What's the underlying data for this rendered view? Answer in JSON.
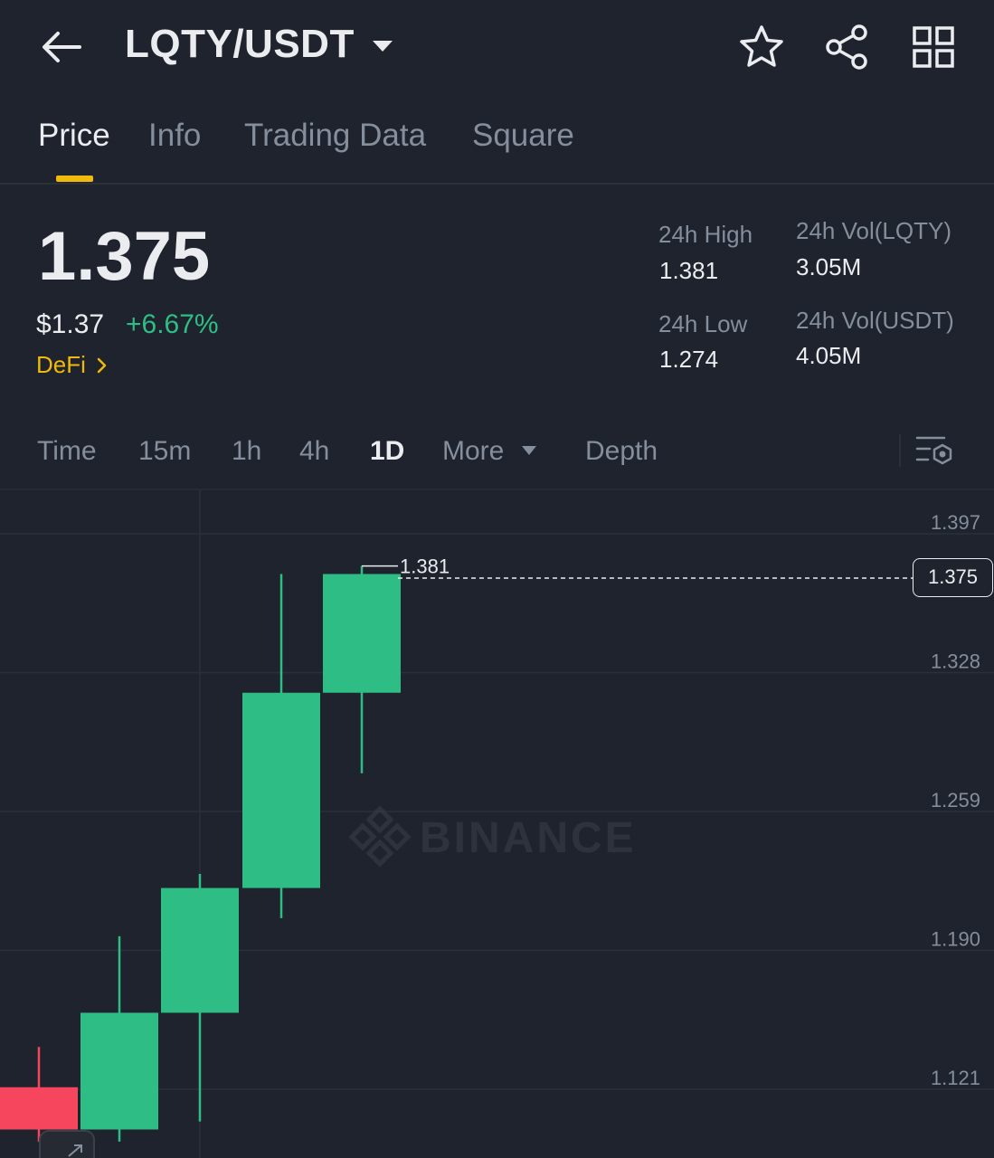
{
  "header": {
    "pair": "LQTY/USDT",
    "icons": [
      "back-arrow-icon",
      "caret-down-icon",
      "star-icon",
      "share-icon",
      "grid-icon"
    ]
  },
  "tabs": [
    {
      "label": "Price",
      "active": true
    },
    {
      "label": "Info",
      "active": false
    },
    {
      "label": "Trading Data",
      "active": false
    },
    {
      "label": "Square",
      "active": false
    }
  ],
  "price": {
    "last": "1.375",
    "usd": "$1.37",
    "change": "+6.67%",
    "tag": "DeFi"
  },
  "stats": {
    "high_label": "24h High",
    "high_value": "1.381",
    "low_label": "24h Low",
    "low_value": "1.274",
    "vol_base_label": "24h Vol(LQTY)",
    "vol_base_value": "3.05M",
    "vol_quote_label": "24h Vol(USDT)",
    "vol_quote_value": "4.05M"
  },
  "intervals": {
    "time": "Time",
    "m15": "15m",
    "h1": "1h",
    "h4": "4h",
    "d1": "1D",
    "more": "More",
    "depth": "Depth",
    "active": "1D"
  },
  "colors": {
    "background": "#1f232d",
    "up": "#2ebd85",
    "down": "#f6465d",
    "accent": "#f0b90b",
    "muted": "#848e9c"
  },
  "chart_data": {
    "type": "candlestick",
    "interval": "1D",
    "y_ticks": [
      "1.397",
      "1.328",
      "1.259",
      "1.190",
      "1.121"
    ],
    "ylim": [
      1.09,
      1.42
    ],
    "candles": [
      {
        "open": 1.122,
        "close": 1.101,
        "high": 1.142,
        "low": 1.095,
        "direction": "down"
      },
      {
        "open": 1.101,
        "close": 1.159,
        "high": 1.197,
        "low": 1.095,
        "direction": "up"
      },
      {
        "open": 1.159,
        "close": 1.221,
        "high": 1.228,
        "low": 1.105,
        "direction": "up"
      },
      {
        "open": 1.221,
        "close": 1.318,
        "high": 1.377,
        "low": 1.206,
        "direction": "up"
      },
      {
        "open": 1.318,
        "close": 1.377,
        "high": 1.381,
        "low": 1.278,
        "direction": "up"
      }
    ],
    "high_marker": "1.381",
    "last_price": "1.375",
    "watermark": "BINANCE"
  }
}
